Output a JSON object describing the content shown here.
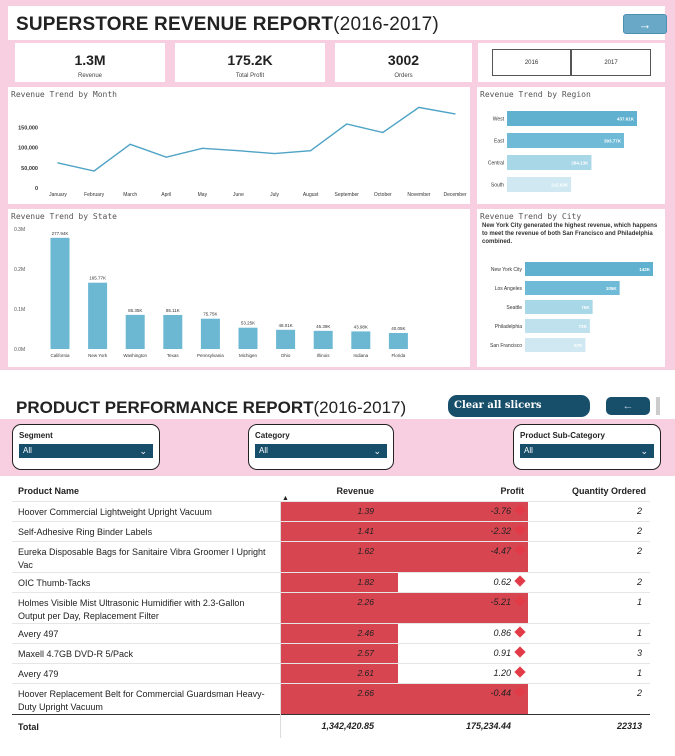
{
  "report1": {
    "title": "SUPERSTORE REVENUE REPORT",
    "title_years": "(2016-2017)",
    "nav_arrow": "→",
    "kpis": [
      {
        "value": "1.3M",
        "label": "Revenue"
      },
      {
        "value": "175.2K",
        "label": "Total Profit"
      },
      {
        "value": "3002",
        "label": "Orders"
      }
    ],
    "years": [
      "2016",
      "2017"
    ],
    "month_panel": {
      "title": "Revenue Trend by Month",
      "y_ticks": [
        "150,000",
        "100,000",
        "50,000",
        "0"
      ],
      "months": [
        "January",
        "February",
        "March",
        "April",
        "May",
        "June",
        "July",
        "August",
        "September",
        "October",
        "November",
        "December"
      ],
      "values": [
        62000,
        42000,
        108000,
        76000,
        98000,
        92000,
        85000,
        92000,
        158000,
        137000,
        199000,
        183000
      ]
    },
    "region_panel": {
      "title": "Revenue Trend by Region",
      "rows": [
        {
          "label": "West",
          "value": 437.61,
          "text": "437.61K",
          "color": "#5fb1cf"
        },
        {
          "label": "East",
          "value": 393.77,
          "text": "393.77K",
          "color": "#6fbad6"
        },
        {
          "label": "Central",
          "value": 284.13,
          "text": "284.13K",
          "color": "#a8d7e7"
        },
        {
          "label": "South",
          "value": 215.83,
          "text": "215.83K",
          "color": "#cfe8f1"
        }
      ]
    },
    "state_panel": {
      "title": "Revenue Trend by State",
      "y_ticks": [
        "0.3M",
        "0.2M",
        "0.1M",
        "0.0M"
      ],
      "states": [
        {
          "label": "California",
          "value": 277.94,
          "text": "277.94K"
        },
        {
          "label": "New York",
          "value": 165.77,
          "text": "165.77K"
        },
        {
          "label": "Washington",
          "value": 85.35,
          "text": "85.35K"
        },
        {
          "label": "Texas",
          "value": 85.11,
          "text": "85.11K"
        },
        {
          "label": "Pennsylvania",
          "value": 75.75,
          "text": "75.75K"
        },
        {
          "label": "Michigen",
          "value": 53.25,
          "text": "53.25K"
        },
        {
          "label": "Ohio",
          "value": 48.01,
          "text": "48.01K"
        },
        {
          "label": "Illinois",
          "value": 45.39,
          "text": "45.39K"
        },
        {
          "label": "Indiana",
          "value": 43.98,
          "text": "43.98K"
        },
        {
          "label": "Florida",
          "value": 40.05,
          "text": "40.05K"
        }
      ]
    },
    "city_panel": {
      "title": "Revenue Trend by City",
      "note": "New York City generated the highest revenue, which happens to meet the revenue of both San Francisco and Philadelphia combined.",
      "rows": [
        {
          "label": "New York City",
          "value": 142,
          "text": "142K",
          "color": "#5fb1cf"
        },
        {
          "label": "Los Angeles",
          "value": 105,
          "text": "105K",
          "color": "#6fbad6"
        },
        {
          "label": "Seattle",
          "value": 75,
          "text": "75K",
          "color": "#a8d7e7"
        },
        {
          "label": "Philadelphia",
          "value": 72,
          "text": "72K",
          "color": "#bfe1ed"
        },
        {
          "label": "San Francisco",
          "value": 67,
          "text": "67K",
          "color": "#cfe8f1"
        }
      ]
    }
  },
  "report2": {
    "title": "PRODUCT PERFORMANCE REPORT",
    "title_years": "(2016-2017)",
    "clear_label": "Clear all slicers",
    "back_arrow": "←",
    "slicers": [
      {
        "label": "Segment",
        "value": "All"
      },
      {
        "label": "Category",
        "value": "All"
      },
      {
        "label": "Product Sub-Category",
        "value": "All"
      }
    ],
    "columns": [
      "Product Name",
      "Revenue",
      "Profit",
      "Quantity Ordered"
    ],
    "rows": [
      {
        "name": "Hoover Commercial Lightweight Upright Vacuum",
        "revenue": "1.39",
        "profit": "-3.76",
        "qty": "2",
        "neg": true
      },
      {
        "name": "Self-Adhesive Ring Binder Labels",
        "revenue": "1.41",
        "profit": "-2.32",
        "qty": "2",
        "neg": true
      },
      {
        "name": "Eureka Disposable Bags for Sanitaire Vibra Groomer I Upright Vac",
        "revenue": "1.62",
        "profit": "-4.47",
        "qty": "2",
        "neg": true
      },
      {
        "name": "OIC Thumb-Tacks",
        "revenue": "1.82",
        "profit": "0.62",
        "qty": "2",
        "neg": false
      },
      {
        "name": "Holmes Visible Mist Ultrasonic Humidifier with 2.3-Gallon Output per Day, Replacement Filter",
        "revenue": "2.26",
        "profit": "-5.21",
        "qty": "1",
        "neg": true
      },
      {
        "name": "Avery 497",
        "revenue": "2.46",
        "profit": "0.86",
        "qty": "1",
        "neg": false
      },
      {
        "name": "Maxell 4.7GB DVD-R 5/Pack",
        "revenue": "2.57",
        "profit": "0.91",
        "qty": "3",
        "neg": false
      },
      {
        "name": "Avery 479",
        "revenue": "2.61",
        "profit": "1.20",
        "qty": "1",
        "neg": false
      },
      {
        "name": "Hoover Replacement Belt for Commercial Guardsman Heavy-Duty Upright Vacuum",
        "revenue": "2.66",
        "profit": "-0.44",
        "qty": "2",
        "neg": true
      }
    ],
    "total": {
      "label": "Total",
      "revenue": "1,342,420.85",
      "profit": "175,234.44",
      "qty": "22313"
    }
  }
}
